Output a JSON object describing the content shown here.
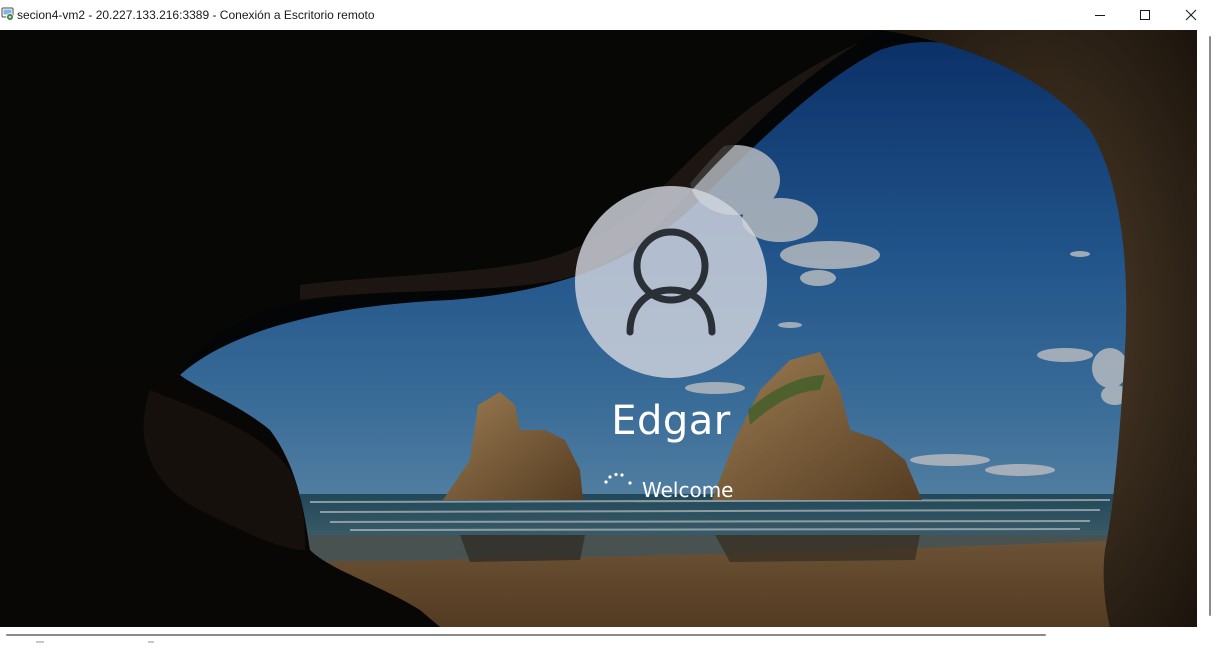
{
  "window": {
    "title": "secion4-vm2 - 20.227.133.216:3389 - Conexión a Escritorio remoto",
    "app_icon": "remote-desktop-icon",
    "controls": {
      "minimize": "minimize-icon",
      "maximize": "maximize-icon",
      "close": "close-icon"
    }
  },
  "lock_screen": {
    "background": "sea-cave-beach-wallpaper",
    "avatar_icon": "user-icon",
    "username": "Edgar",
    "status": "Welcome",
    "spinner_icon": "loading-spinner-icon"
  },
  "colors": {
    "titlebar_bg": "#ffffff",
    "text_primary": "#ffffff",
    "avatar_circle": "#d2d6de",
    "avatar_glyph": "#2b2f36"
  }
}
